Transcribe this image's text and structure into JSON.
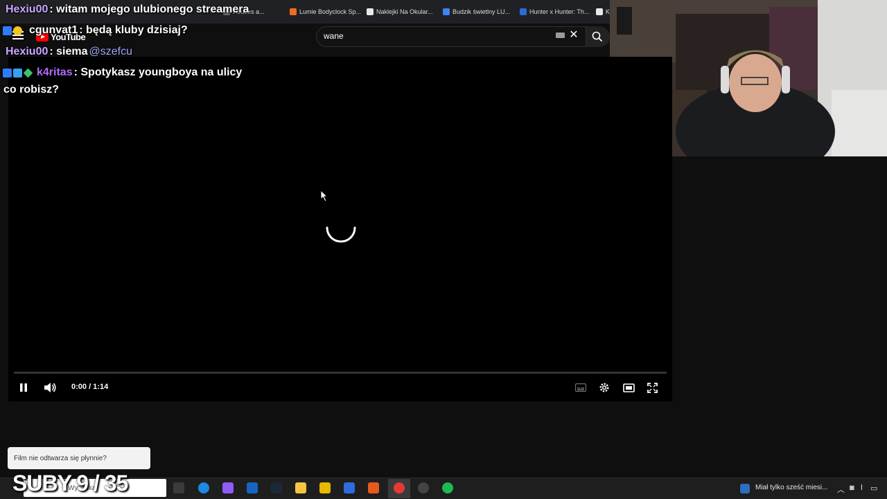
{
  "browser": {
    "bookmarks": [
      {
        "label": "Houses a...",
        "color": "#6b6b6b"
      },
      {
        "label": "Lumie Bodyclock Sp...",
        "color": "#f26b21"
      },
      {
        "label": "Naklejki Na Okular...",
        "color": "#e8e8e8"
      },
      {
        "label": "Budzik świetlny LU...",
        "color": "#3b82f6"
      },
      {
        "label": "Hunter x Hunter: Th...",
        "color": "#2a6cd6"
      },
      {
        "label": "K",
        "color": "#e8e8e8"
      }
    ]
  },
  "youtube": {
    "logo_text": "YouTube",
    "search_value": "wane"
  },
  "player": {
    "time": "0:00 / 1:14",
    "progress_fraction": 0.0
  },
  "chat": [
    {
      "user": "Hexiu00",
      "message": " : witam mojego ulubionego streamera",
      "mention": ""
    },
    {
      "user": "cgunvat1",
      "message": " : będą kluby dzisiaj?",
      "mention": ""
    },
    {
      "user": "Hexiu00",
      "message": " : siema ",
      "mention": "@szefcu"
    },
    {
      "user": "k4ritas",
      "message": " : Spotykasz youngboya na ulicy",
      "mention": ""
    },
    {
      "user": "",
      "message": "co robisz?",
      "mention": ""
    }
  ],
  "toast": {
    "text": "Film nie odtwarza się płynnie?"
  },
  "subs_counter": "SUBY 9 / 35",
  "taskbar": {
    "search_text": "Wyszukaj",
    "news_text": "Miał tylko sześć miesi..."
  }
}
